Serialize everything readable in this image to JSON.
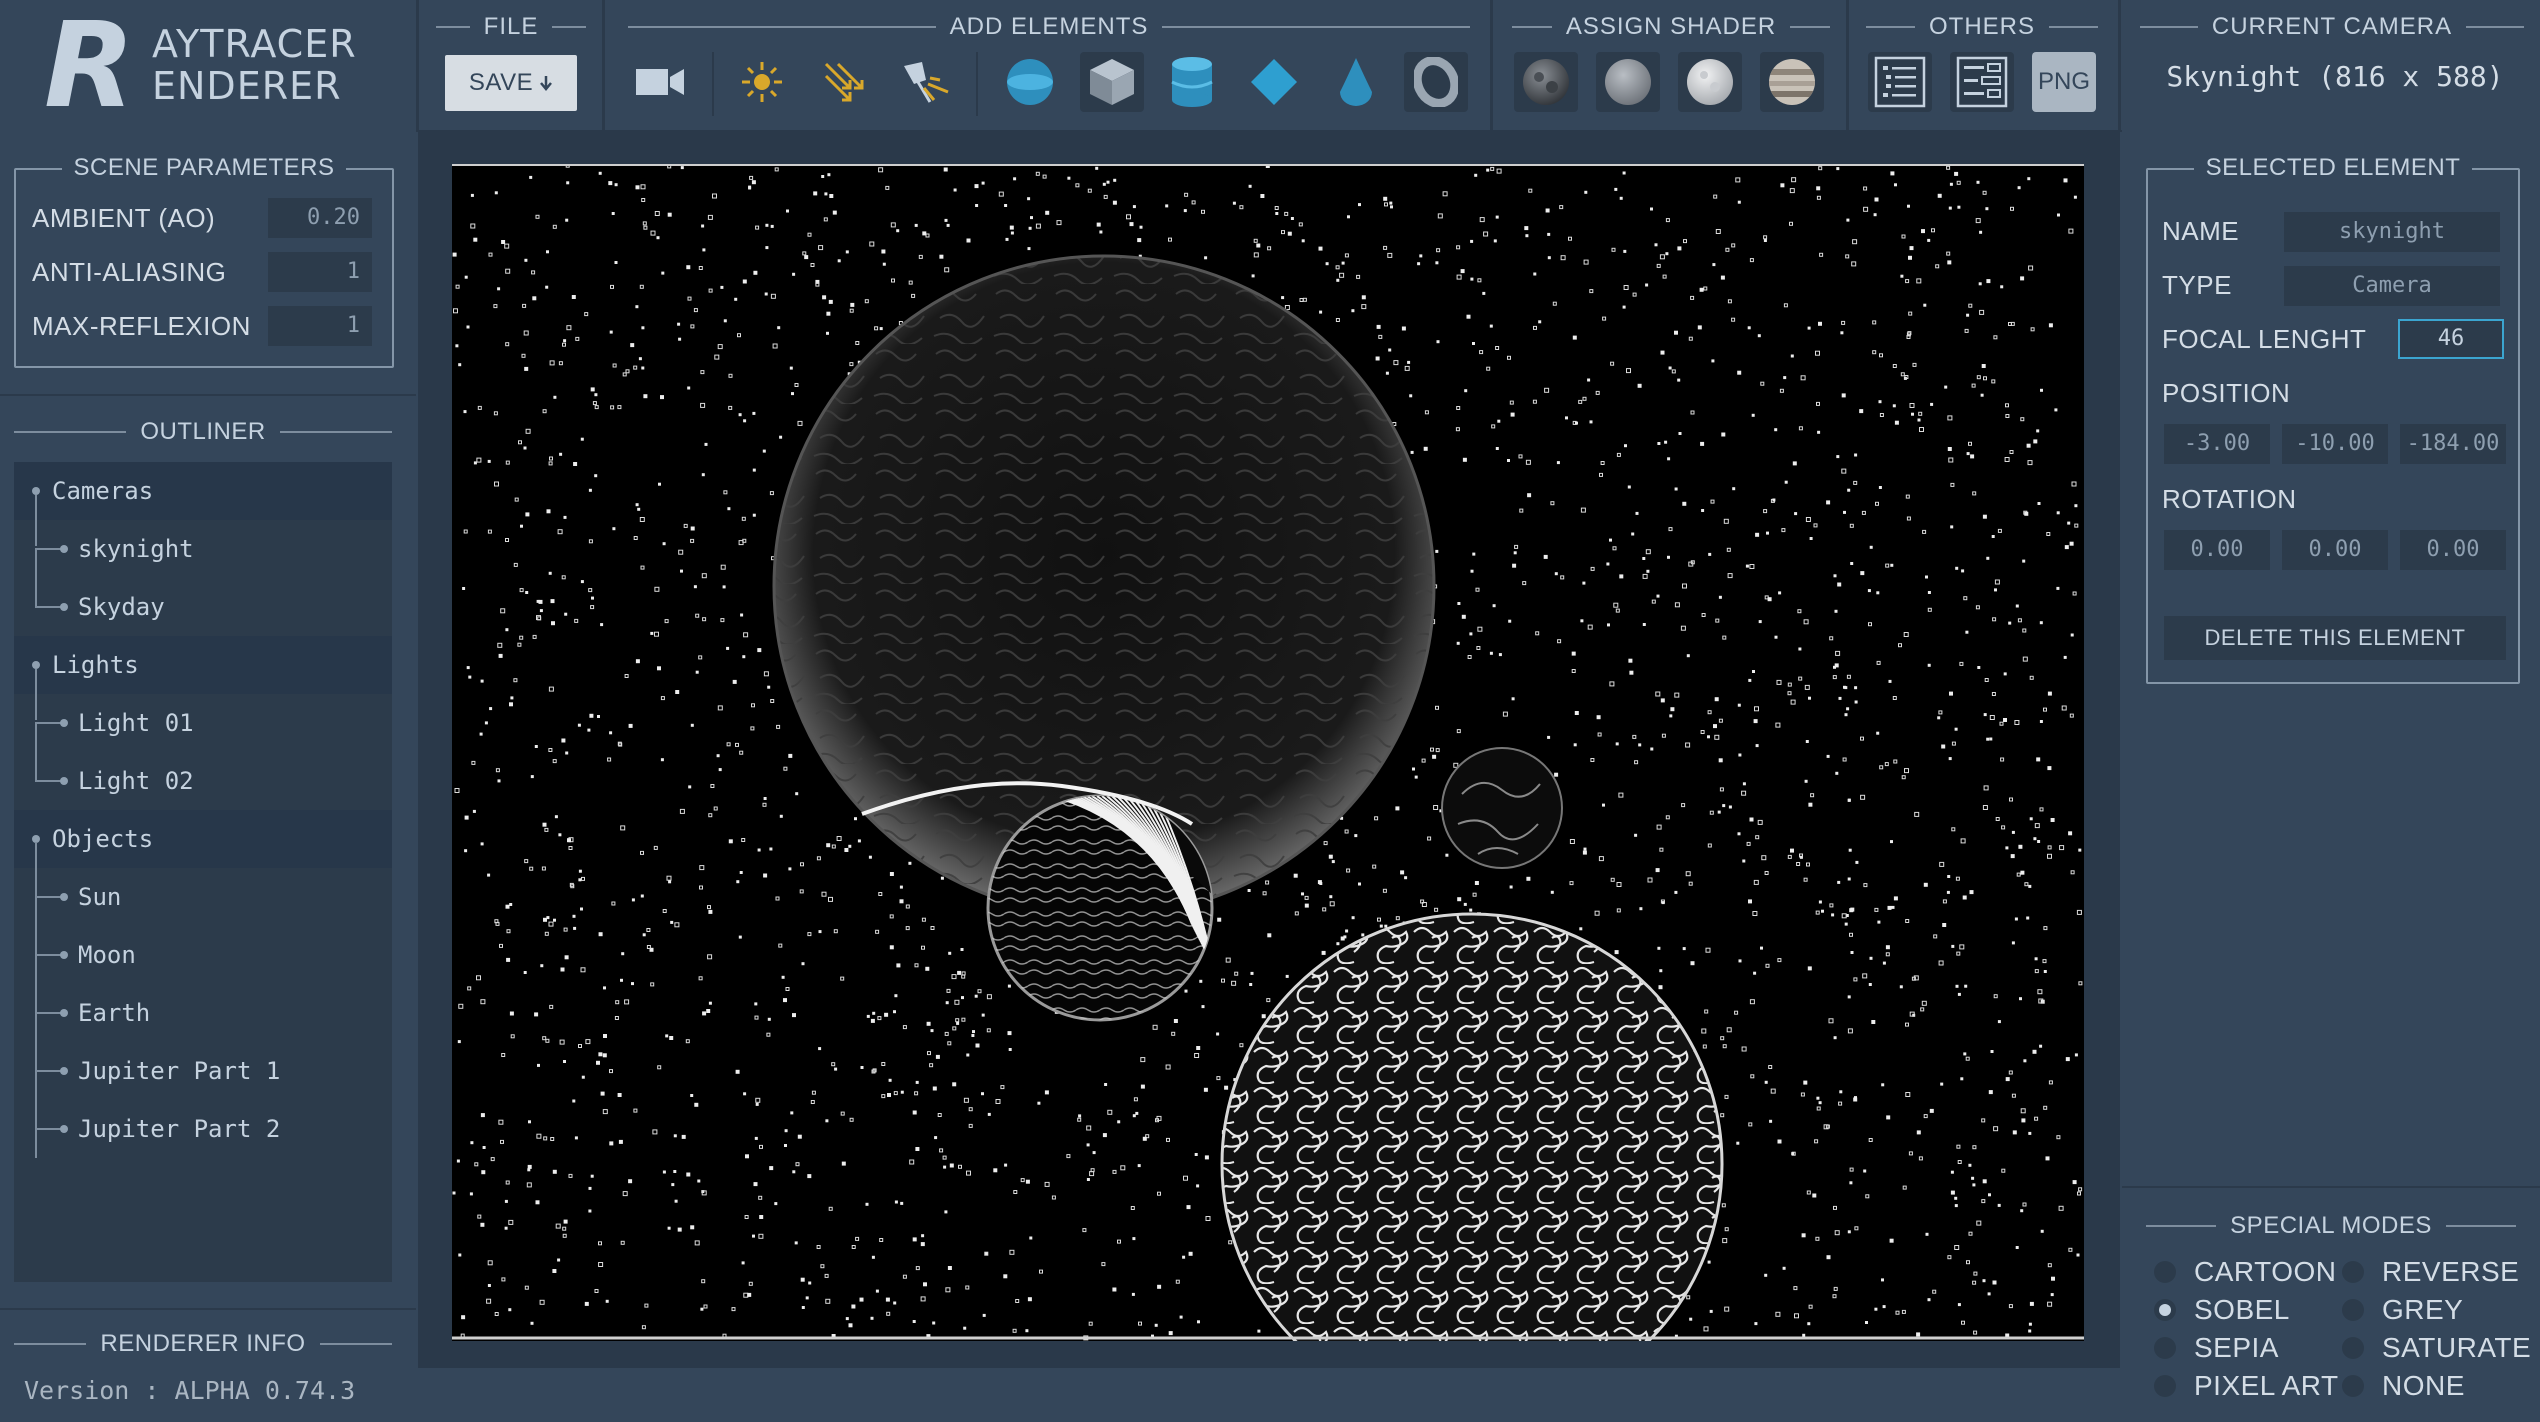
{
  "app": {
    "logo_letter": "R",
    "logo_line1": "AYTRACER",
    "logo_line2": "ENDERER"
  },
  "toolbar": {
    "file_title": "FILE",
    "save_label": "SAVE",
    "save_icon": "download-arrow-icon",
    "add_elements_title": "ADD ELEMENTS",
    "assign_shader_title": "ASSIGN SHADER",
    "others_title": "OTHERS",
    "current_camera_title": "CURRENT CAMERA",
    "current_camera_value": "Skynight (816 x 588)",
    "png_label": "PNG",
    "accent_color": "#3ba5d0",
    "add_tools": [
      "camera-icon",
      "point-light-icon",
      "directional-light-icon",
      "spot-light-icon",
      "sphere-icon",
      "cube-icon",
      "cylinder-icon",
      "diamond-icon",
      "cone-icon",
      "torus-icon"
    ],
    "shader_tools": [
      "rock-shader-icon",
      "matte-shader-icon",
      "moon-shader-icon",
      "gas-giant-shader-icon"
    ],
    "other_tools": [
      "list-view-icon",
      "tree-view-icon",
      "png-export-icon"
    ]
  },
  "scene_parameters": {
    "title": "SCENE PARAMETERS",
    "rows": [
      {
        "label": "AMBIENT (AO)",
        "value": "0.20"
      },
      {
        "label": "ANTI-ALIASING",
        "value": "1"
      },
      {
        "label": "MAX-REFLEXION",
        "value": "1"
      }
    ]
  },
  "outliner": {
    "title": "OUTLINER",
    "groups": [
      {
        "label": "Cameras",
        "items": [
          "skynight",
          "Skyday"
        ]
      },
      {
        "label": "Lights",
        "items": [
          "Light 01",
          "Light 02"
        ]
      },
      {
        "label": "Objects",
        "items": [
          "Sun",
          "Moon",
          "Earth",
          "Jupiter Part 1",
          "Jupiter Part 2"
        ]
      }
    ]
  },
  "renderer_info": {
    "title": "RENDERER INFO",
    "version": "Version : ALPHA 0.74.3"
  },
  "selected_element": {
    "title": "SELECTED ELEMENT",
    "name_label": "NAME",
    "name_value": "skynight",
    "type_label": "TYPE",
    "type_value": "Camera",
    "focal_label": "FOCAL LENGHT",
    "focal_value": "46",
    "position_label": "POSITION",
    "position": [
      "-3.00",
      "-10.00",
      "-184.00"
    ],
    "rotation_label": "ROTATION",
    "rotation": [
      "0.00",
      "0.00",
      "0.00"
    ],
    "delete_label": "DELETE THIS ELEMENT"
  },
  "special_modes": {
    "title": "SPECIAL MODES",
    "selected": "SOBEL",
    "left": [
      "CARTOON",
      "SOBEL",
      "SEPIA",
      "PIXEL ART"
    ],
    "right": [
      "REVERSE",
      "GREY",
      "SATURATE",
      "NONE"
    ]
  },
  "render": {
    "background": "#000000",
    "filter": "sobel"
  }
}
